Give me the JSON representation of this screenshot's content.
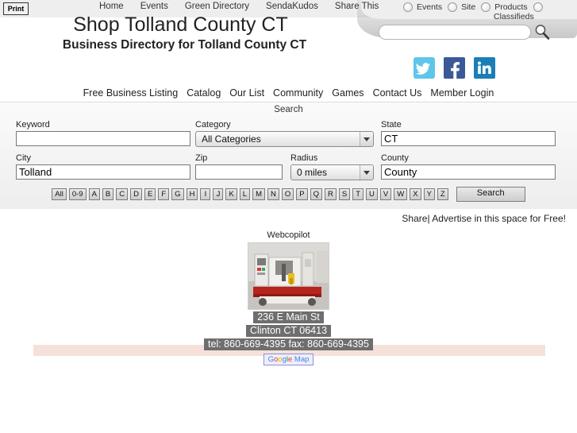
{
  "header": {
    "print_label": "Print",
    "site_title": "Shop Tolland County CT",
    "site_subtitle": "Business Directory for Tolland County CT",
    "topnav": [
      {
        "label": "Home"
      },
      {
        "label": "Events"
      },
      {
        "label": "Green Directory"
      },
      {
        "label": "SendaKudos"
      },
      {
        "label": "Share This"
      }
    ],
    "search_scopes": [
      {
        "label": "Events"
      },
      {
        "label": "Site"
      },
      {
        "label": "Products"
      },
      {
        "label": "Classifieds"
      }
    ],
    "search_input_value": "",
    "search_input_placeholder": "",
    "search_icon": "magnifier-icon",
    "social": [
      {
        "name": "twitter-icon",
        "label": "Twitter"
      },
      {
        "name": "facebook-icon",
        "label": "Facebook"
      },
      {
        "name": "linkedin-icon",
        "label": "LinkedIn"
      }
    ]
  },
  "mainnav": [
    {
      "label": "Free Business Listing"
    },
    {
      "label": "Catalog"
    },
    {
      "label": "Our List"
    },
    {
      "label": "Community"
    },
    {
      "label": "Games"
    },
    {
      "label": "Contact Us"
    },
    {
      "label": "Member Login"
    }
  ],
  "search": {
    "heading": "Search",
    "keyword_label": "Keyword",
    "keyword_value": "",
    "category_label": "Category",
    "category_value": "All Categories",
    "state_label": "State",
    "state_value": "CT",
    "city_label": "City",
    "city_value": "Tolland",
    "zip_label": "Zip",
    "zip_value": "",
    "radius_label": "Radius",
    "radius_value": "0 miles",
    "county_label": "County",
    "county_value": "County",
    "alpha_buttons": [
      "All",
      "0-9",
      "A",
      "B",
      "C",
      "D",
      "E",
      "F",
      "G",
      "H",
      "I",
      "J",
      "K",
      "L",
      "M",
      "N",
      "O",
      "P",
      "Q",
      "R",
      "S",
      "T",
      "U",
      "V",
      "W",
      "X",
      "Y",
      "Z"
    ],
    "search_button_label": "Search"
  },
  "share_line": {
    "share_label": "Share",
    "separator": "|",
    "advertise_label": "Advertise in this space for Free!"
  },
  "listing": {
    "title": "Webcopilot",
    "photo_alt": "industrial-machine-photo",
    "address_line1": "236 E Main St",
    "address_line2": "Clinton CT 06413",
    "contact_line": "tel: 860-669-4395 fax: 860-669-4395",
    "map_link_label": "Google Map",
    "map_link_word_google": "Google",
    "map_link_word_map": "Map"
  },
  "colors": {
    "page_background": "#ffffff",
    "search_panel": "#f2f2f2",
    "address_badge": "#6e6e6e",
    "pink_band": "#f5e0da",
    "nav_text": "#333333"
  }
}
